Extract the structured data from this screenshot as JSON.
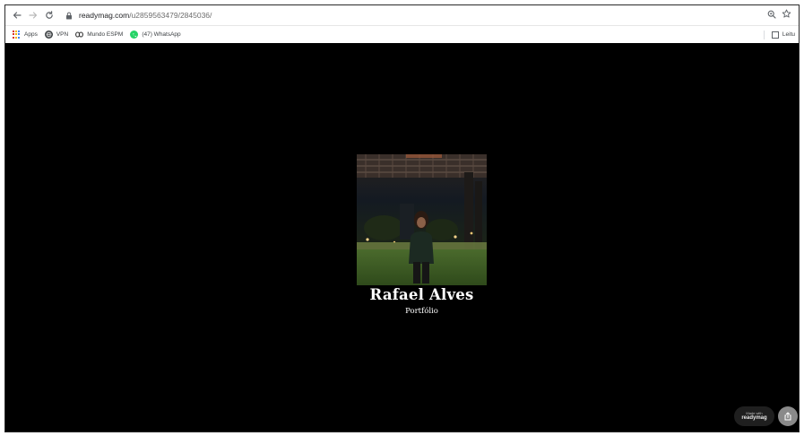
{
  "browser": {
    "url_host": "readymag.com",
    "url_path": "/u2859563479/2845036/",
    "bookmarks": [
      {
        "label": "Apps",
        "icon": "apps-grid-icon"
      },
      {
        "label": "VPN",
        "icon": "globe-icon"
      },
      {
        "label": "Mundo ESPM",
        "icon": "mundo-espm-icon"
      },
      {
        "label": "(47) WhatsApp",
        "icon": "whatsapp-icon"
      }
    ],
    "reading_list_label": "Leitu"
  },
  "page": {
    "title": "Rafael Alves",
    "subtitle": "Portfólio"
  },
  "badge": {
    "made_with": "Made with",
    "brand": "readymag"
  },
  "colors": {
    "background": "#000000",
    "text": "#ffffff",
    "share_button": "#8a8a8a"
  }
}
